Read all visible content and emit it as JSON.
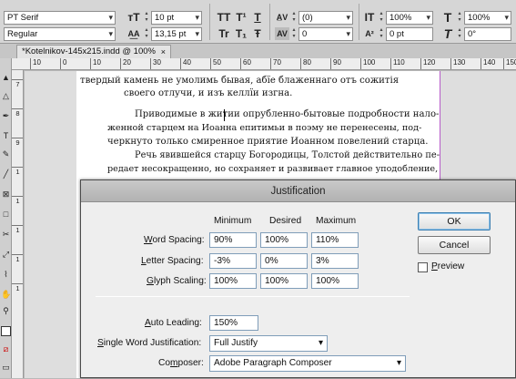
{
  "control_panel": {
    "font_family": "PT Serif",
    "font_style": "Regular",
    "font_size": "10 pt",
    "leading": "13,15 pt",
    "tracking": "(0)",
    "kerning": "0",
    "vertical_scale": "100%",
    "horizontal_scale": "100%",
    "baseline_shift": "0 pt",
    "skew": "0°",
    "char_buttons_row1": [
      "TT",
      "T¹",
      "T"
    ],
    "char_buttons_row2": [
      "Tr",
      "T₁",
      "Ŧ"
    ]
  },
  "document_tab": {
    "title": "*Kotelnikov-145x215.indd @ 100%",
    "close": "×"
  },
  "ruler": {
    "h_labels": [
      "10",
      "0",
      "10",
      "20",
      "30",
      "40",
      "50",
      "60",
      "70",
      "80",
      "90",
      "100",
      "110",
      "120",
      "130",
      "140",
      "150"
    ],
    "v_labels": [
      "7",
      "8",
      "9",
      "1",
      "1",
      "1",
      "1",
      "1"
    ]
  },
  "page_text": {
    "line1": "твердый камень не умолимь бывая, абїе блаженнаго отъ сожитія",
    "line2": "своего отлучи, и изъ келлїи изгна.",
    "line3": "Приводимые в житии опрубленно-бытовые подробности нало-",
    "line4": "женной старцем на Иоанна епитимьи в поэму не перенесены, под-",
    "line5": "черкнуто только смиренное приятие Иоанном повелений старца.",
    "line6": "Речь явившейся старцу Богородицы, Толстой действительно пе-",
    "line7": "редает несокращенно, но сохраняет и развивает главное уподобление,"
  },
  "dialog": {
    "title": "Justification",
    "col_minimum": "Minimum",
    "col_desired": "Desired",
    "col_maximum": "Maximum",
    "word_spacing": {
      "label_u": "W",
      "label_rest": "ord Spacing:",
      "min": "90%",
      "desired": "100%",
      "max": "110%"
    },
    "letter_spacing": {
      "label_u": "L",
      "label_rest": "etter Spacing:",
      "min": "-3%",
      "desired": "0%",
      "max": "3%"
    },
    "glyph_scaling": {
      "label_u": "G",
      "label_rest": "lyph Scaling:",
      "min": "100%",
      "desired": "100%",
      "max": "100%"
    },
    "auto_leading": {
      "label_u": "A",
      "label_rest": "uto Leading:",
      "value": "150%"
    },
    "single_word": {
      "label_u": "S",
      "label_rest": "ingle Word Justification:",
      "value": "Full Justify"
    },
    "composer": {
      "label_pre": "Co",
      "label_u": "m",
      "label_rest": "poser:",
      "value": "Adobe Paragraph Composer"
    },
    "ok": "OK",
    "cancel": "Cancel",
    "preview_u": "P",
    "preview_rest": "review"
  }
}
